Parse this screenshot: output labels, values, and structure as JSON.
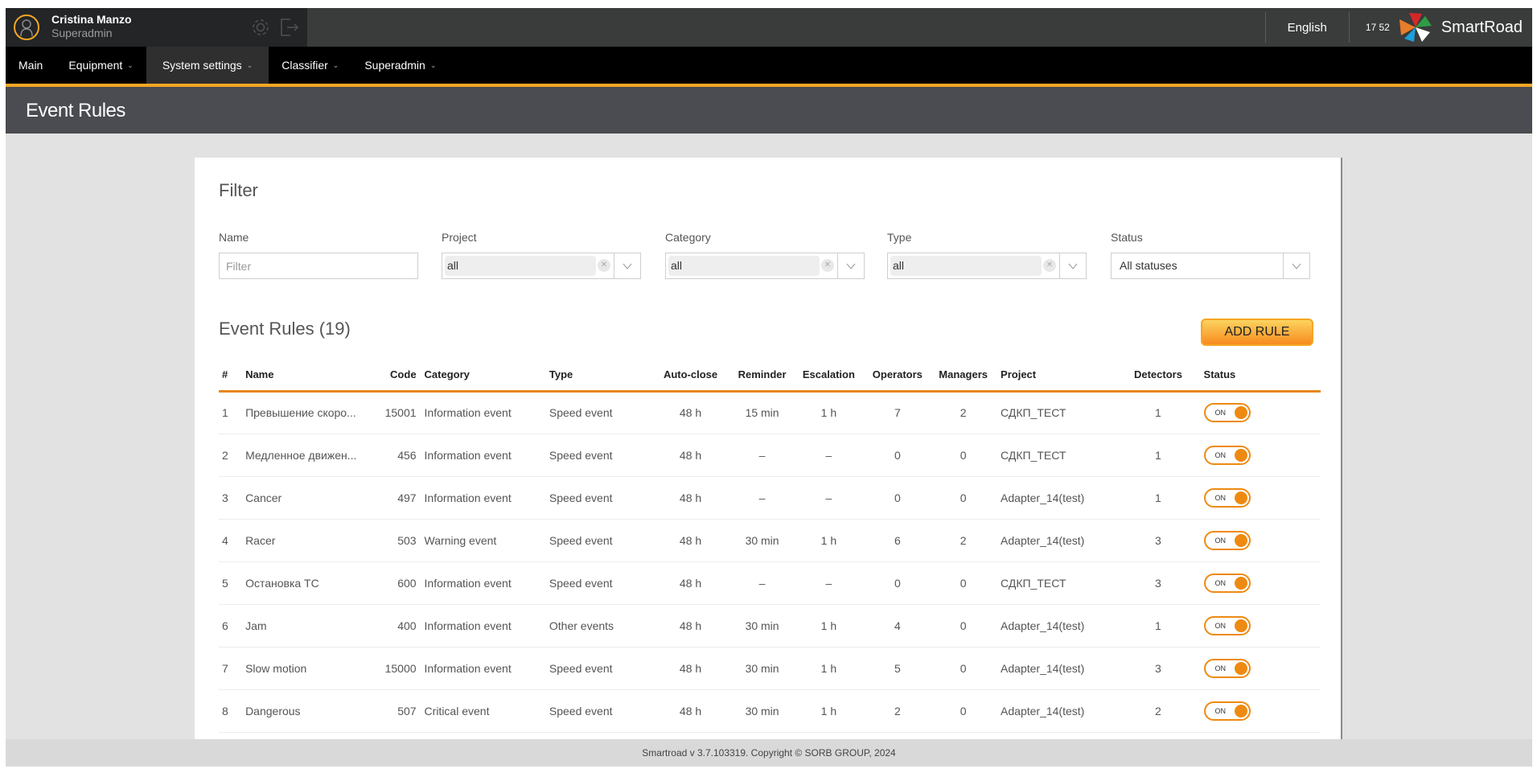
{
  "user": {
    "name": "Cristina Manzo",
    "role": "Superadmin"
  },
  "topbar": {
    "language": "English",
    "time": "17 52",
    "brand": "SmartRoad"
  },
  "nav": {
    "items": [
      {
        "label": "Main",
        "has_dropdown": false,
        "active": false
      },
      {
        "label": "Equipment",
        "has_dropdown": true,
        "active": false
      },
      {
        "label": "System settings",
        "has_dropdown": true,
        "active": true
      },
      {
        "label": "Classifier",
        "has_dropdown": true,
        "active": false
      },
      {
        "label": "Superadmin",
        "has_dropdown": true,
        "active": false
      }
    ]
  },
  "page": {
    "title": "Event Rules"
  },
  "filter": {
    "title": "Filter",
    "name": {
      "label": "Name",
      "placeholder": "Filter",
      "value": ""
    },
    "project": {
      "label": "Project",
      "value": "all"
    },
    "category": {
      "label": "Category",
      "value": "all"
    },
    "type": {
      "label": "Type",
      "value": "all"
    },
    "status": {
      "label": "Status",
      "value": "All statuses"
    }
  },
  "rules": {
    "title": "Event Rules (19)",
    "add_button": "ADD RULE",
    "columns": [
      "#",
      "Name",
      "Code",
      "Category",
      "Type",
      "Auto-close",
      "Reminder",
      "Escalation",
      "Operators",
      "Managers",
      "Project",
      "Detectors",
      "Status"
    ],
    "rows": [
      {
        "num": "1",
        "name": "Превышение скоро...",
        "code": "15001",
        "category": "Information event",
        "type": "Speed event",
        "auto_close": "48 h",
        "reminder": "15 min",
        "escalation": "1 h",
        "operators": "7",
        "managers": "2",
        "project": "СДКП_ТЕСТ",
        "detectors": "1",
        "status": "ON"
      },
      {
        "num": "2",
        "name": "Медленное движен...",
        "code": "456",
        "category": "Information event",
        "type": "Speed event",
        "auto_close": "48 h",
        "reminder": "–",
        "escalation": "–",
        "operators": "0",
        "managers": "0",
        "project": "СДКП_ТЕСТ",
        "detectors": "1",
        "status": "ON"
      },
      {
        "num": "3",
        "name": "Cancer",
        "code": "497",
        "category": "Information event",
        "type": "Speed event",
        "auto_close": "48 h",
        "reminder": "–",
        "escalation": "–",
        "operators": "0",
        "managers": "0",
        "project": "Adapter_14(test)",
        "detectors": "1",
        "status": "ON"
      },
      {
        "num": "4",
        "name": "Racer",
        "code": "503",
        "category": "Warning event",
        "type": "Speed event",
        "auto_close": "48 h",
        "reminder": "30 min",
        "escalation": "1 h",
        "operators": "6",
        "managers": "2",
        "project": "Adapter_14(test)",
        "detectors": "3",
        "status": "ON"
      },
      {
        "num": "5",
        "name": "Остановка ТС",
        "code": "600",
        "category": "Information event",
        "type": "Speed event",
        "auto_close": "48 h",
        "reminder": "–",
        "escalation": "–",
        "operators": "0",
        "managers": "0",
        "project": "СДКП_ТЕСТ",
        "detectors": "3",
        "status": "ON"
      },
      {
        "num": "6",
        "name": "Jam",
        "code": "400",
        "category": "Information event",
        "type": "Other events",
        "auto_close": "48 h",
        "reminder": "30 min",
        "escalation": "1 h",
        "operators": "4",
        "managers": "0",
        "project": "Adapter_14(test)",
        "detectors": "1",
        "status": "ON"
      },
      {
        "num": "7",
        "name": "Slow motion",
        "code": "15000",
        "category": "Information event",
        "type": "Speed event",
        "auto_close": "48 h",
        "reminder": "30 min",
        "escalation": "1 h",
        "operators": "5",
        "managers": "0",
        "project": "Adapter_14(test)",
        "detectors": "3",
        "status": "ON"
      },
      {
        "num": "8",
        "name": "Dangerous",
        "code": "507",
        "category": "Critical event",
        "type": "Speed event",
        "auto_close": "48 h",
        "reminder": "30 min",
        "escalation": "1 h",
        "operators": "2",
        "managers": "0",
        "project": "Adapter_14(test)",
        "detectors": "2",
        "status": "ON"
      }
    ]
  },
  "footer": {
    "text": "Smartroad v 3.7.103319. Copyright © SORB GROUP, 2024"
  },
  "colors": {
    "accent": "#f5a623",
    "toggle": "#ee8a12",
    "header_underline": "#e8861c"
  }
}
